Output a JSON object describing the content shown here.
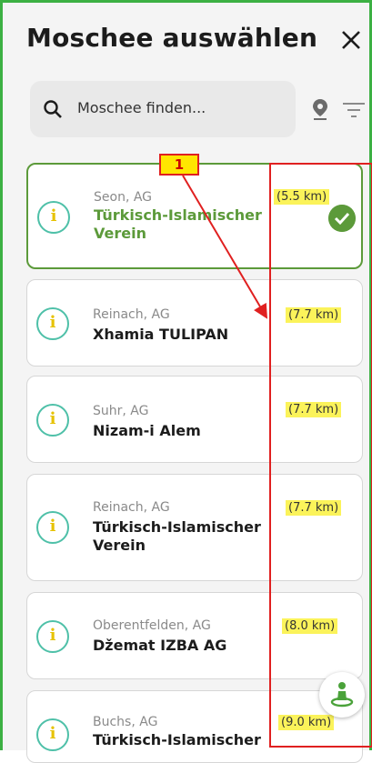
{
  "header": {
    "title": "Moschee auswählen"
  },
  "search": {
    "placeholder": "Moschee finden..."
  },
  "mosques": [
    {
      "city": "Seon, AG",
      "name": "Türkisch-Islamischer Verein",
      "distance": "(5.5 km)",
      "selected": true
    },
    {
      "city": "Reinach, AG",
      "name": "Xhamia TULIPAN",
      "distance": "(7.7 km)",
      "selected": false
    },
    {
      "city": "Suhr, AG",
      "name": "Nizam-i Alem",
      "distance": "(7.7 km)",
      "selected": false
    },
    {
      "city": "Reinach, AG",
      "name": "Türkisch-Islamischer Verein",
      "distance": "(7.7 km)",
      "selected": false
    },
    {
      "city": "Oberentfelden, AG",
      "name": "Džemat IZBA AG",
      "distance": "(8.0 km)",
      "selected": false
    },
    {
      "city": "Buchs, AG",
      "name": "Türkisch-Islamischer",
      "distance": "(9.0 km)",
      "selected": false
    }
  ],
  "annotation": {
    "badge": "1"
  },
  "colors": {
    "accent": "#5c9a3a",
    "highlight": "#fbf35a",
    "annotation": "#e02020"
  }
}
